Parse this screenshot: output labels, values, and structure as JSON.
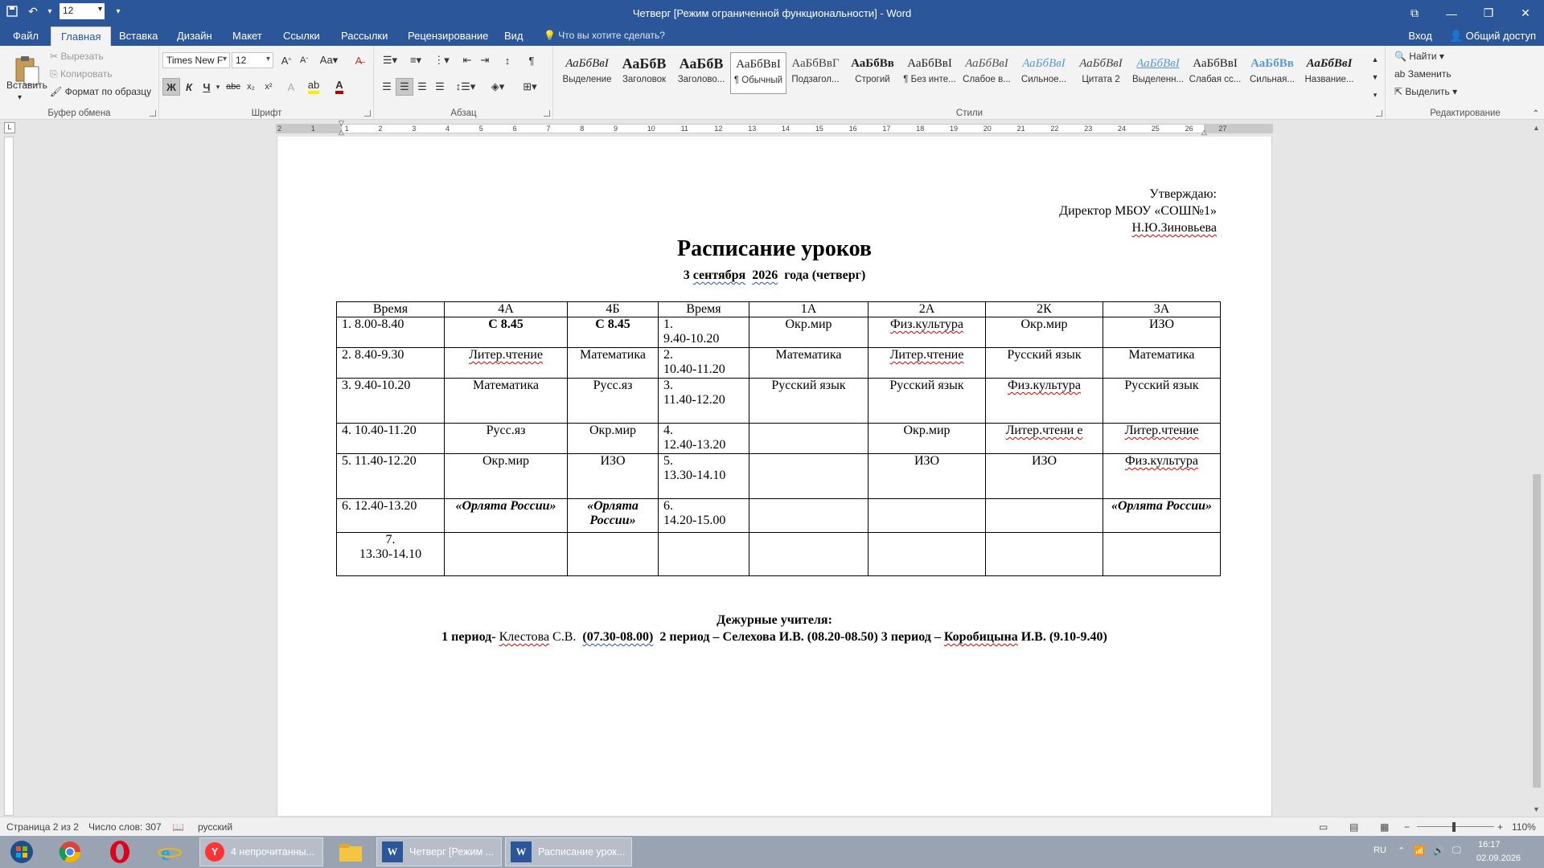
{
  "window": {
    "title": "Четверг [Режим ограниченной функциональности] - Word",
    "font_size_quick": "12",
    "controls": [
      "⧉",
      "—",
      "❐",
      "✕"
    ]
  },
  "tabs": [
    "Файл",
    "Главная",
    "Вставка",
    "Дизайн",
    "Макет",
    "Ссылки",
    "Рассылки",
    "Рецензирование",
    "Вид"
  ],
  "active_tab": "Главная",
  "tell_me": "Что вы хотите сделать?",
  "signin": "Вход",
  "share": "Общий доступ",
  "ribbon": {
    "clipboard": {
      "paste": "Вставить",
      "cut": "Вырезать",
      "copy": "Копировать",
      "format_painter": "Формат по образцу",
      "label": "Буфер обмена"
    },
    "font": {
      "font_name": "Times New F",
      "font_size": "12",
      "label": "Шрифт"
    },
    "paragraph": {
      "label": "Абзац"
    },
    "styles": {
      "label": "Стили",
      "items": [
        {
          "sample": "АаБбВвІ",
          "name": "Выделение"
        },
        {
          "sample": "АаБбВ",
          "name": "Заголовок"
        },
        {
          "sample": "АаБбВ",
          "name": "Заголово..."
        },
        {
          "sample": "АаБбВвІ",
          "name": "¶ Обычный"
        },
        {
          "sample": "АаБбВвГ",
          "name": "Подзагол..."
        },
        {
          "sample": "АаБбВв",
          "name": "Строгий"
        },
        {
          "sample": "АаБбВвІ",
          "name": "¶ Без инте..."
        },
        {
          "sample": "АаБбВвІ",
          "name": "Слабое в..."
        },
        {
          "sample": "АаБбВвІ",
          "name": "Сильное..."
        },
        {
          "sample": "АаБбВвІ",
          "name": "Цитата 2"
        },
        {
          "sample": "АаБбВвІ",
          "name": "Выделенн..."
        },
        {
          "sample": "АаБбВвІ",
          "name": "Слабая сс..."
        },
        {
          "sample": "АаБбВв",
          "name": "Сильная..."
        },
        {
          "sample": "АаБбВвІ",
          "name": "Название..."
        }
      ]
    },
    "editing": {
      "find": "Найти",
      "replace": "Заменить",
      "select": "Выделить",
      "label": "Редактирование"
    }
  },
  "ruler": {
    "ticks": [
      "2",
      "1",
      "1",
      "2",
      "3",
      "4",
      "5",
      "6",
      "7",
      "8",
      "9",
      "10",
      "11",
      "12",
      "13",
      "14",
      "15",
      "16",
      "17",
      "18",
      "19",
      "20",
      "21",
      "22",
      "23",
      "24",
      "25",
      "26",
      "27"
    ]
  },
  "document": {
    "approve": [
      "Утверждаю:",
      "Директор МБОУ «СОШ№1»",
      "Н.Ю.Зиновьева"
    ],
    "title": "Расписание уроков",
    "subtitle_num": "3",
    "subtitle_month": "сентября",
    "subtitle_year": "2026",
    "subtitle_rest": "года (четверг)",
    "table": {
      "headers": [
        "Время",
        "4А",
        "4Б",
        "Время",
        "1А",
        "2А",
        "2К",
        "3А"
      ],
      "rows": [
        [
          "1. 8.00-8.40",
          "С 8.45",
          "С 8.45",
          "1.\n 9.40-10.20",
          "Окр.мир",
          "Физ.культура",
          "Окр.мир",
          "ИЗО"
        ],
        [
          "2. 8.40-9.30",
          "Литер.чтение",
          "Математика",
          "2.\n 10.40-11.20",
          "Математика",
          "Литер.чтение",
          "Русский язык",
          "Математика"
        ],
        [
          "3. 9.40-10.20",
          "Математика",
          "Русс.яз",
          "3.\n11.40-12.20",
          "Русский язык",
          "Русский язык",
          "Физ.культура",
          "Русский язык"
        ],
        [
          "4. 10.40-11.20",
          "Русс.яз",
          "Окр.мир",
          "4.\n12.40-13.20",
          "",
          "Окр.мир",
          "Литер.чтени е",
          "Литер.чтение"
        ],
        [
          "5. 11.40-12.20",
          "Окр.мир",
          "ИЗО",
          "5.\n13.30-14.10",
          "",
          "ИЗО",
          "ИЗО",
          "Физ.культура"
        ],
        [
          "6. 12.40-13.20",
          "«Орлята России»",
          "«Орлята России»",
          "6.\n14.20-15.00",
          "",
          "",
          "",
          "«Орлята России»"
        ],
        [
          "7.\n13.30-14.10",
          "",
          "",
          "",
          "",
          "",
          "",
          ""
        ]
      ]
    },
    "duty_title": "Дежурные учителя:",
    "duty": {
      "p1": "1 период-",
      "p1_name": "Клестова",
      "p1_init": "С.В.",
      "p1_time": "(07.30-08.00)",
      "p2": "2 период – Селехова И.В.   (08.20-08.50) 3 период –",
      "p3_name": "Коробицына",
      "p3_rest": "И.В. (9.10-9.40)"
    }
  },
  "status": {
    "page": "Страница 2 из 2",
    "words": "Число слов: 307",
    "lang": "русский",
    "zoom": "110%"
  },
  "taskbar": {
    "apps": [
      {
        "label": "4 непрочитанны..."
      },
      {
        "label": "Четверг [Режим ..."
      },
      {
        "label": "Расписание урок..."
      }
    ],
    "lang": "RU",
    "time": "16:17",
    "date": "02.09.2026"
  },
  "colors": {
    "word_blue": "#2b579a",
    "spell_red": "#d00000",
    "grammar_blue": "#2850c8"
  }
}
